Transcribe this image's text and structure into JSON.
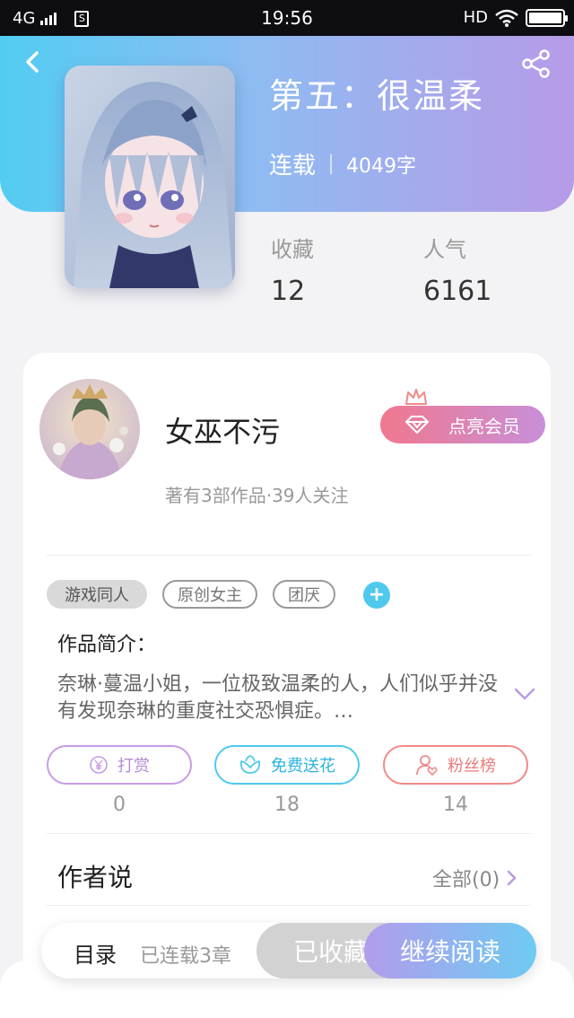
{
  "status_bar": {
    "network": "4G",
    "sim_icon": "S",
    "time": "19:56",
    "hd": "HD"
  },
  "header": {
    "back_icon": "chevron-left-icon",
    "share_icon": "share-icon"
  },
  "book": {
    "title": "第五：很温柔",
    "status": "连载",
    "word_count": "4049字",
    "stats": [
      {
        "label": "收藏",
        "value": "12"
      },
      {
        "label": "人气",
        "value": "6161"
      }
    ]
  },
  "author": {
    "name": "女巫不污",
    "info": "著有3部作品·39人关注",
    "vip_label": "点亮会员"
  },
  "tags": [
    "游戏同人",
    "原创女主",
    "团厌"
  ],
  "tag_add": "+",
  "intro": {
    "title": "作品简介：",
    "text": "奈琳·蔓温小姐，一位极致温柔的人，人们似乎并没有发现奈琳的重度社交恐惧症。…"
  },
  "actions": [
    {
      "label": "打赏",
      "count": "0",
      "color": "#c79be6",
      "icon": "yen-icon"
    },
    {
      "label": "免费送花",
      "count": "18",
      "color": "#4fc9ee",
      "icon": "flower-icon"
    },
    {
      "label": "粉丝榜",
      "count": "14",
      "color": "#f08a8a",
      "icon": "fan-icon"
    }
  ],
  "author_says": {
    "title": "作者说",
    "all_label": "全部(0)"
  },
  "bottom_bar": {
    "toc_label": "目录",
    "serial_label": "已连载3章",
    "collected_label": "已收藏",
    "continue_label": "继续阅读"
  },
  "colors": {
    "header_start": "#52cdf2",
    "header_end": "#b79be8",
    "accent_blue": "#4fc9ee",
    "accent_purple": "#b29cec",
    "vip_pink": "#f0788e"
  }
}
